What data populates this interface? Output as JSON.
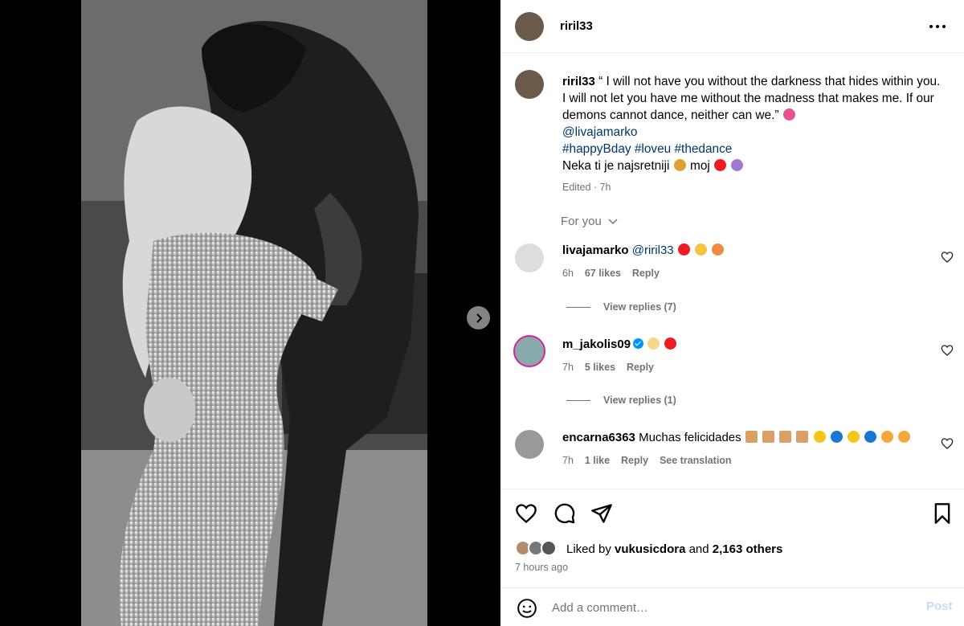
{
  "post": {
    "author": "riril33",
    "caption_text": "“ I will not have you without the darkness that hides within you. I will not let you have me without the madness that makes me. If our demons cannot dance, neither can we.”",
    "caption_mention": "@livajamarko",
    "caption_tags": "#happyBday #loveu #thedance",
    "caption_line2_a": "Neka ti je najsretniji",
    "caption_line2_b": "moj",
    "edited": "Edited · 7h"
  },
  "for_you": "For you",
  "comments": [
    {
      "user": "livajamarko",
      "text": "@riril33",
      "time": "6h",
      "likes": "67 likes",
      "reply": "Reply",
      "view_replies": "View replies (7)"
    },
    {
      "user": "m_jakolis09",
      "text": "",
      "time": "7h",
      "likes": "5 likes",
      "reply": "Reply",
      "view_replies": "View replies (1)"
    },
    {
      "user": "encarna6363",
      "text": "Muchas felicidades",
      "time": "7h",
      "likes": "1 like",
      "reply": "Reply",
      "translate": "See translation"
    }
  ],
  "likes": {
    "prefix": "Liked by",
    "user": "vukusicdora",
    "and": "and",
    "others": "2,163 others"
  },
  "timestamp": "7 hours ago",
  "add_comment": {
    "placeholder": "Add a comment…",
    "post_label": "Post"
  },
  "colors": {
    "red_heart": "#ed1c24",
    "link": "#00376b",
    "muted": "#737373",
    "post_disabled": "#c4dcfb"
  }
}
